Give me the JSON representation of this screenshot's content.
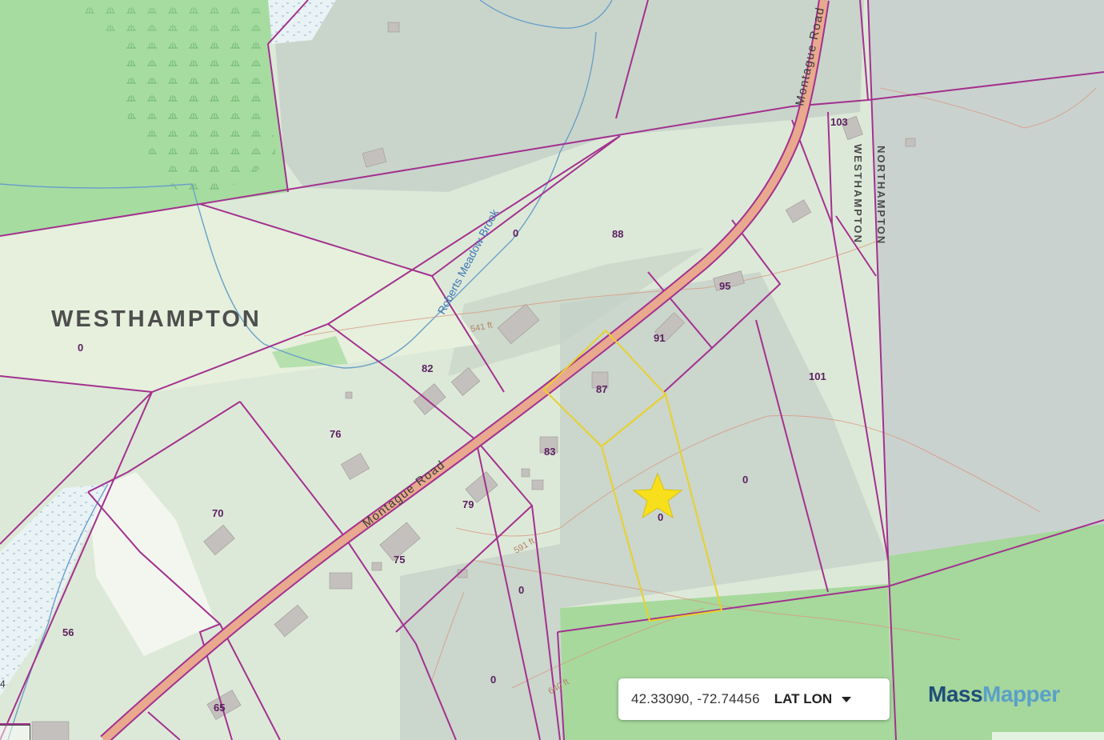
{
  "map": {
    "town_label": "WESTHAMPTON",
    "town_line_west": "WESTHAMPTON",
    "town_line_east": "NORTHAMPTON",
    "road_name": "Montague Road",
    "road_name_top": "Montague Road",
    "brook_name": "Roberts Meadow Brook",
    "contours": [
      "541 ft",
      "591 ft",
      "640 ft"
    ],
    "parcels": {
      "p0_west": "0",
      "p0_north": "0",
      "p88": "88",
      "p95": "95",
      "p91": "91",
      "p87": "87",
      "p101": "101",
      "p103": "103",
      "p82": "82",
      "p76": "76",
      "p83": "83",
      "p0_subject": "0",
      "p0_east": "0",
      "p70": "70",
      "p79": "79",
      "p75": "75",
      "p0_south1": "0",
      "p56": "56",
      "p0_south2": "0",
      "p65": "65"
    },
    "scale_fragment": "4",
    "colors": {
      "parcel_line": "#a3318f",
      "selected_parcel": "#e8d12a",
      "star": "#f7e01b",
      "road": "#e8a98f",
      "stream": "#6aa0c8",
      "contour": "#d89a80",
      "forest": "#9fd69a"
    }
  },
  "coordinates": {
    "value": "42.33090, -72.74456",
    "mode_label": "LAT LON",
    "dropdown_icon": "caret-down-icon"
  },
  "brand": {
    "part1": "Mass",
    "part2": "Mapper"
  }
}
